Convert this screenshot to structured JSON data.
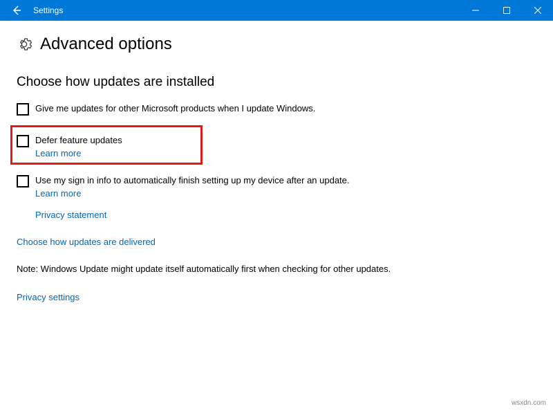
{
  "titlebar": {
    "title": "Settings"
  },
  "header": {
    "title": "Advanced options"
  },
  "section": {
    "title": "Choose how updates are installed"
  },
  "options": {
    "otherProducts": {
      "label": "Give me updates for other Microsoft products when I update Windows."
    },
    "defer": {
      "label": "Defer feature updates",
      "learnMore": "Learn more"
    },
    "signin": {
      "label": "Use my sign in info to automatically finish setting up my device after an update.",
      "learnMore": "Learn more",
      "privacy": "Privacy statement"
    }
  },
  "links": {
    "delivered": "Choose how updates are delivered",
    "privacySettings": "Privacy settings"
  },
  "note": "Note: Windows Update might update itself automatically first when checking for other updates.",
  "watermark": "wsxdn.com"
}
